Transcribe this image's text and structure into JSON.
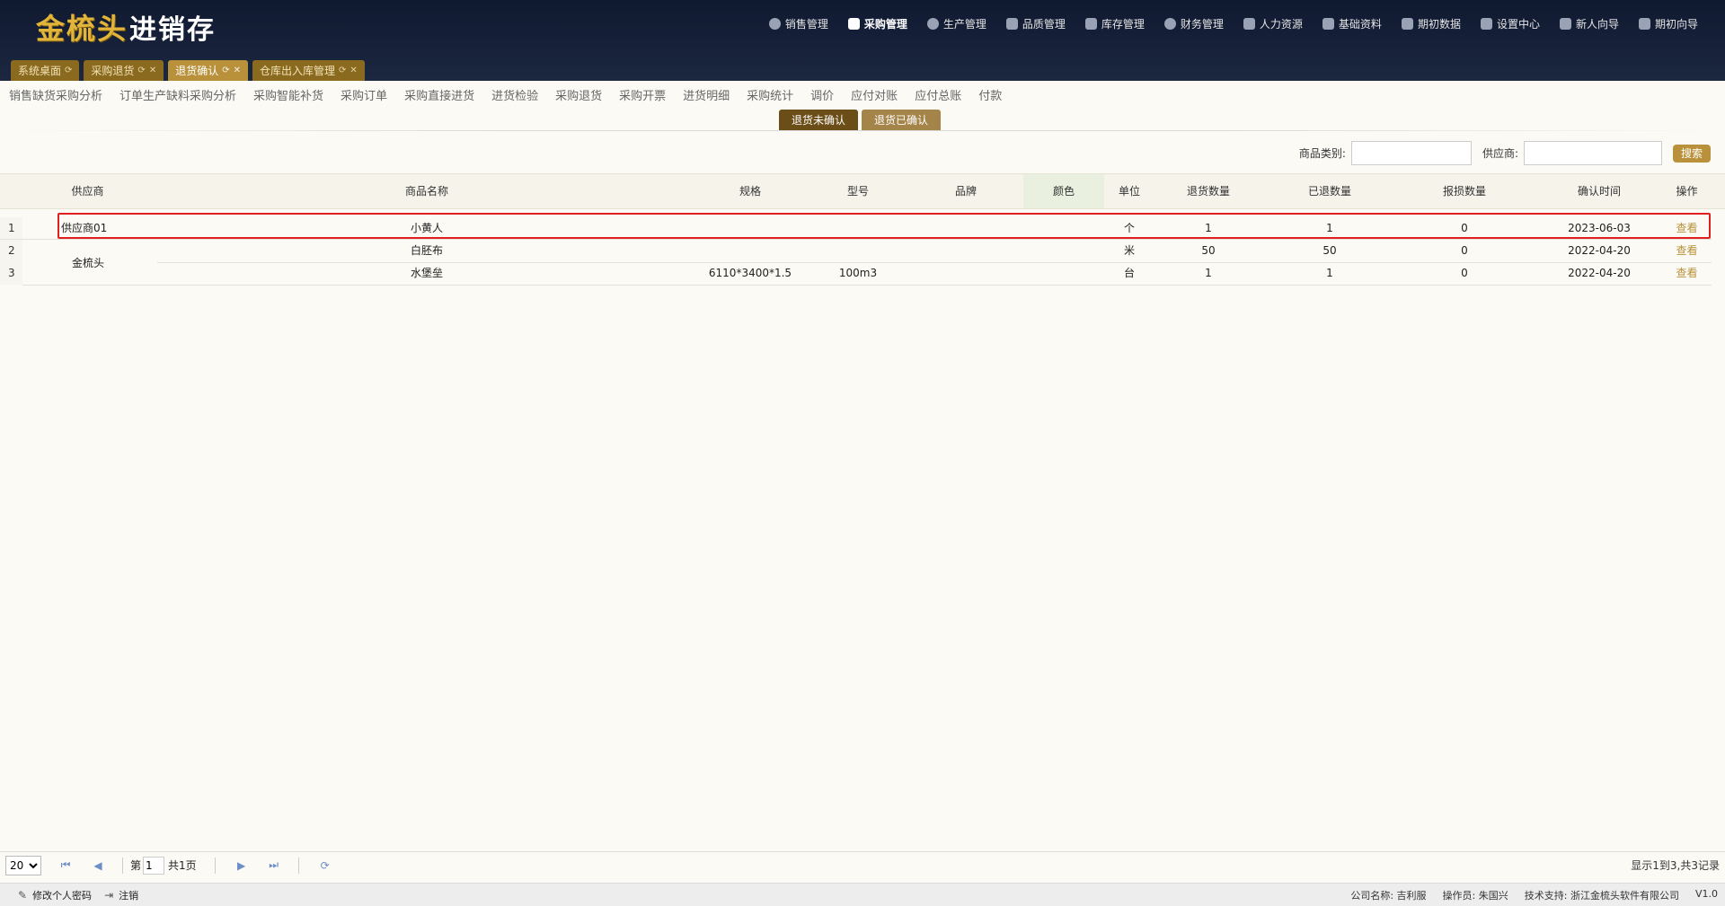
{
  "app": {
    "logo_mark": "金梳头",
    "logo_rest": "进销存"
  },
  "topnav": [
    {
      "label": "销售管理",
      "icon": "clock-icon"
    },
    {
      "label": "采购管理",
      "icon": "bookmark-icon"
    },
    {
      "label": "生产管理",
      "icon": "gear-icon"
    },
    {
      "label": "品质管理",
      "icon": "shield-icon"
    },
    {
      "label": "库存管理",
      "icon": "grid-icon"
    },
    {
      "label": "财务管理",
      "icon": "yen-icon"
    },
    {
      "label": "人力资源",
      "icon": "users-icon"
    },
    {
      "label": "基础资料",
      "icon": "book-icon"
    },
    {
      "label": "期初数据",
      "icon": "database-icon"
    },
    {
      "label": "设置中心",
      "icon": "sliders-icon"
    },
    {
      "label": "新人向导",
      "icon": "user-guide-icon"
    },
    {
      "label": "期初向导",
      "icon": "puzzle-icon"
    }
  ],
  "tabs": [
    {
      "label": "系统桌面"
    },
    {
      "label": "采购退货"
    },
    {
      "label": "退货确认"
    },
    {
      "label": "仓库出入库管理"
    }
  ],
  "submenu": [
    "销售缺货采购分析",
    "订单生产缺料采购分析",
    "采购智能补货",
    "采购订单",
    "采购直接进货",
    "进货检验",
    "采购退货",
    "采购开票",
    "进货明细",
    "采购统计",
    "调价",
    "应付对账",
    "应付总账",
    "付款"
  ],
  "status_tabs": {
    "unconfirmed": "退货未确认",
    "confirmed": "退货已确认"
  },
  "search": {
    "category_label": "商品类别:",
    "supplier_label": "供应商:",
    "button": "搜索"
  },
  "grid": {
    "columns": [
      "供应商",
      "商品名称",
      "规格",
      "型号",
      "品牌",
      "颜色",
      "单位",
      "退货数量",
      "已退数量",
      "报损数量",
      "确认时间",
      "操作"
    ],
    "rows": [
      {
        "idx": "1",
        "supplier": "供应商01",
        "name": "小黄人",
        "spec": "",
        "model": "",
        "brand": "",
        "color": "",
        "unit": "个",
        "ret_qty": "1",
        "done_qty": "1",
        "loss_qty": "0",
        "time": "2023-06-03",
        "action": "查看"
      },
      {
        "idx": "2",
        "supplier": "",
        "name": "白胚布",
        "spec": "",
        "model": "",
        "brand": "",
        "color": "",
        "unit": "米",
        "ret_qty": "50",
        "done_qty": "50",
        "loss_qty": "0",
        "time": "2022-04-20",
        "action": "查看"
      },
      {
        "idx": "3",
        "supplier": "",
        "name": "水堡垒",
        "spec": "6110*3400*1.5",
        "model": "100m3",
        "brand": "",
        "color": "",
        "unit": "台",
        "ret_qty": "1",
        "done_qty": "1",
        "loss_qty": "0",
        "time": "2022-04-20",
        "action": "查看"
      }
    ],
    "merged_supplier": "金梳头"
  },
  "pager": {
    "page_size": "20",
    "page_prefix": "第",
    "page_value": "1",
    "page_total": "共1页",
    "info": "显示1到3,共3记录"
  },
  "footer": {
    "change_password": "修改个人密码",
    "logout": "注销",
    "company": "公司名称: 吉利服",
    "operator": "操作员: 朱国兴",
    "support": "技术支持: 浙江金梳头软件有限公司",
    "version": "V1.0"
  }
}
